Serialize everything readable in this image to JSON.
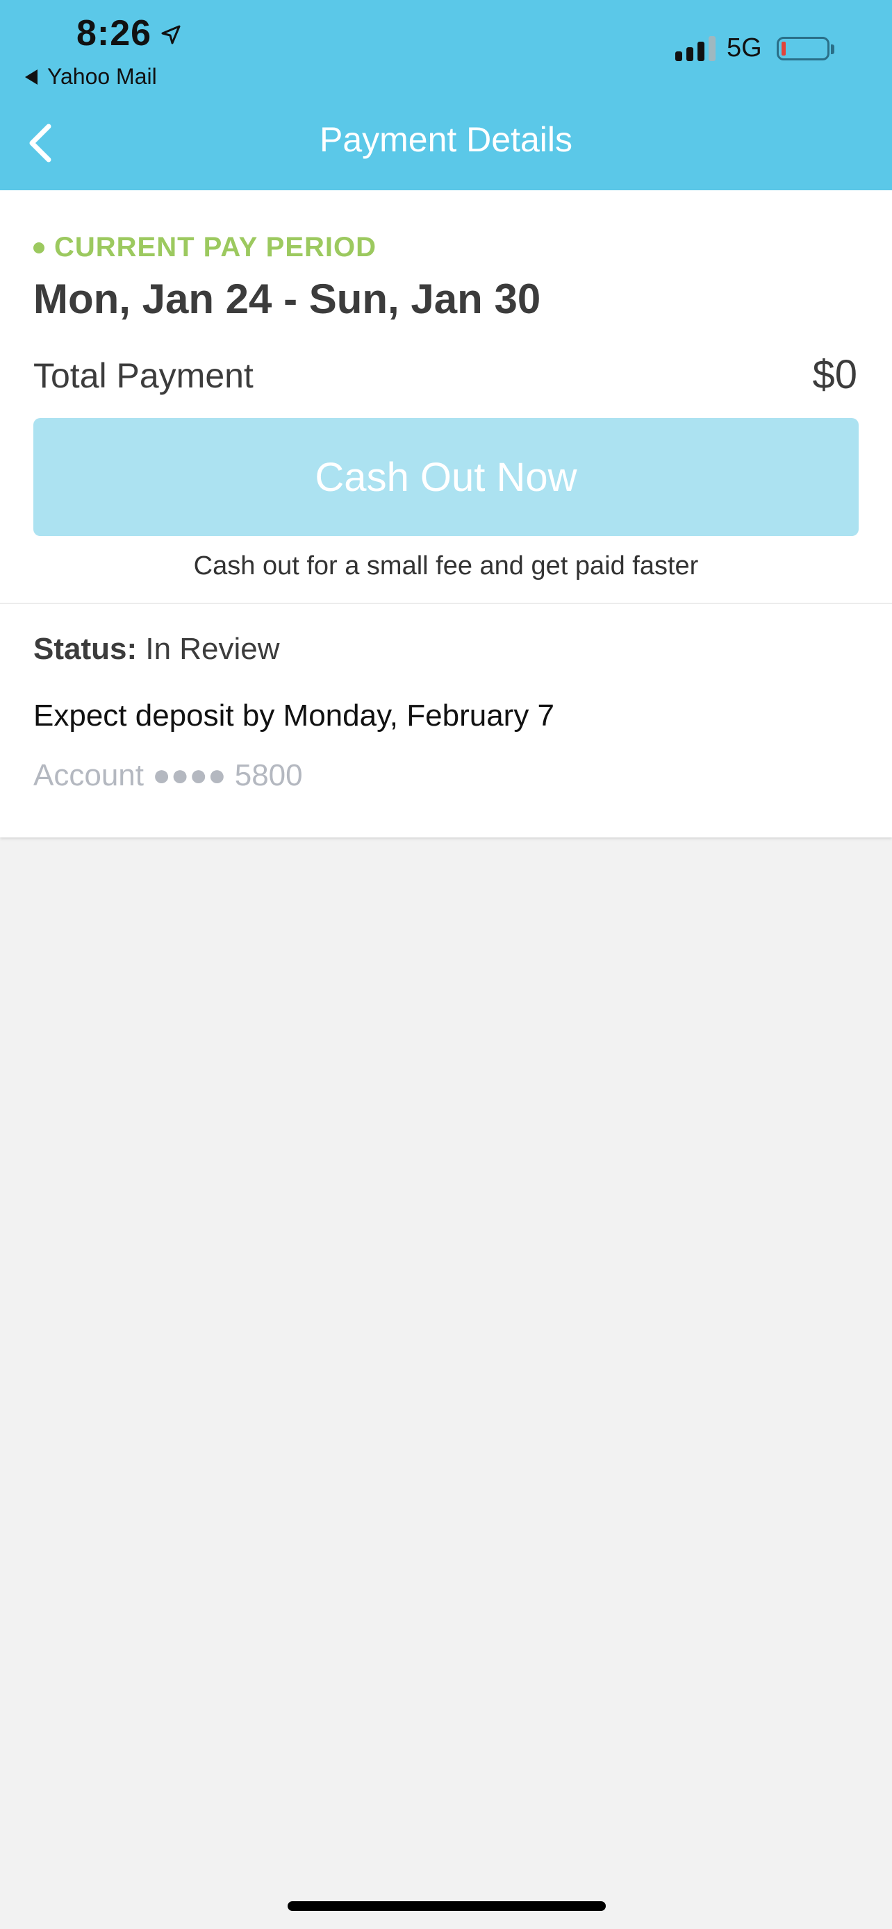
{
  "colors": {
    "accent": "#5bc8e8",
    "period_green": "#9cc95f",
    "button_disabled": "#ace2f1"
  },
  "status_bar": {
    "time": "8:26",
    "back_app": "Yahoo Mail",
    "network": "5G",
    "icons": [
      "location-arrow-icon",
      "signal-icon",
      "battery-icon"
    ]
  },
  "nav": {
    "title": "Payment Details",
    "back_icon": "chevron-left-icon"
  },
  "period": {
    "label": "CURRENT PAY PERIOD",
    "dates": "Mon, Jan 24 - Sun, Jan 30"
  },
  "payment": {
    "total_label": "Total Payment",
    "total_value": "$0",
    "cash_out_button": "Cash Out Now",
    "cash_out_note": "Cash out for a small fee and get paid faster"
  },
  "details": {
    "status_label": "Status:",
    "status_value": "In Review",
    "deposit_text": "Expect deposit by Monday, February 7",
    "account_text": "Account ●●●● 5800"
  }
}
